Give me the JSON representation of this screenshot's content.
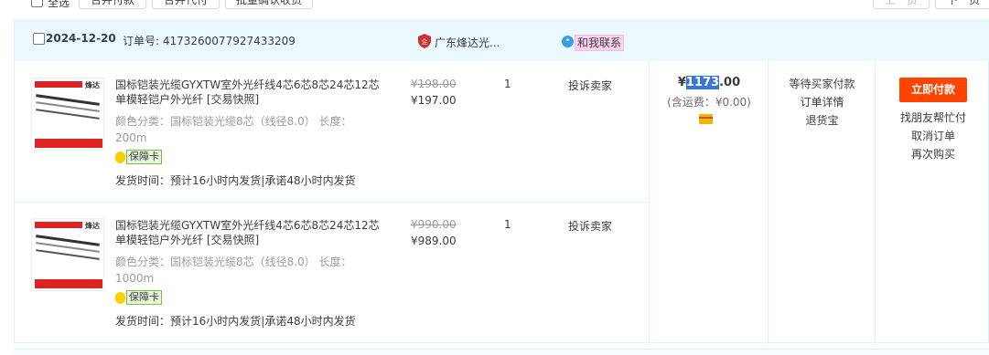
{
  "topbar": {
    "select_all": "全选",
    "merge_pay": "合并付款",
    "merge_proxy": "合并代付",
    "batch_confirm": "批量确认收货",
    "prev_page": "上一页",
    "next_page": "下一页"
  },
  "order": {
    "date": "2024-12-20",
    "order_no": "订单号: 4173260077927433209",
    "shop_name": "广东烽达光...",
    "contact": "和我联系",
    "items": [
      {
        "title": "国标铠装光缆GYXTW室外光纤线4芯6芯8芯24芯12芯单模轻铠户外光纤 [交易快照]",
        "spec": "颜色分类：国标铠装光缆8芯（线径8.0） 长度：200m",
        "badge": "保障卡",
        "ship": "发货时间：预计16小时内发货|承诺48小时内发货",
        "old_price": "¥198.00",
        "price": "¥197.00",
        "qty": "1",
        "complain": "投诉卖家"
      },
      {
        "title": "国标铠装光缆GYXTW室外光纤线4芯6芯8芯24芯12芯单模轻铠户外光纤 [交易快照]",
        "spec": "颜色分类：国标铠装光缆8芯（线径8.0） 长度：1000m",
        "badge": "保障卡",
        "ship": "发货时间：预计16小时内发货|承诺48小时内发货",
        "old_price": "¥990.00",
        "price": "¥989.00",
        "qty": "1",
        "complain": "投诉卖家"
      }
    ],
    "total_prefix": "¥",
    "total_selected": "1173",
    "total_suffix": ".00",
    "freight": "(含运费：¥0.00)",
    "status": [
      "等待买家付款",
      "订单详情",
      "退货宝"
    ],
    "pay_button": "立即付款",
    "ops": [
      "找朋友帮忙付",
      "取消订单",
      "再次购买"
    ]
  },
  "colors": {
    "accent": "#ff4400",
    "header_bg": "#eaf8ff",
    "border": "#daf3ff",
    "highlight": "#3875d7"
  }
}
